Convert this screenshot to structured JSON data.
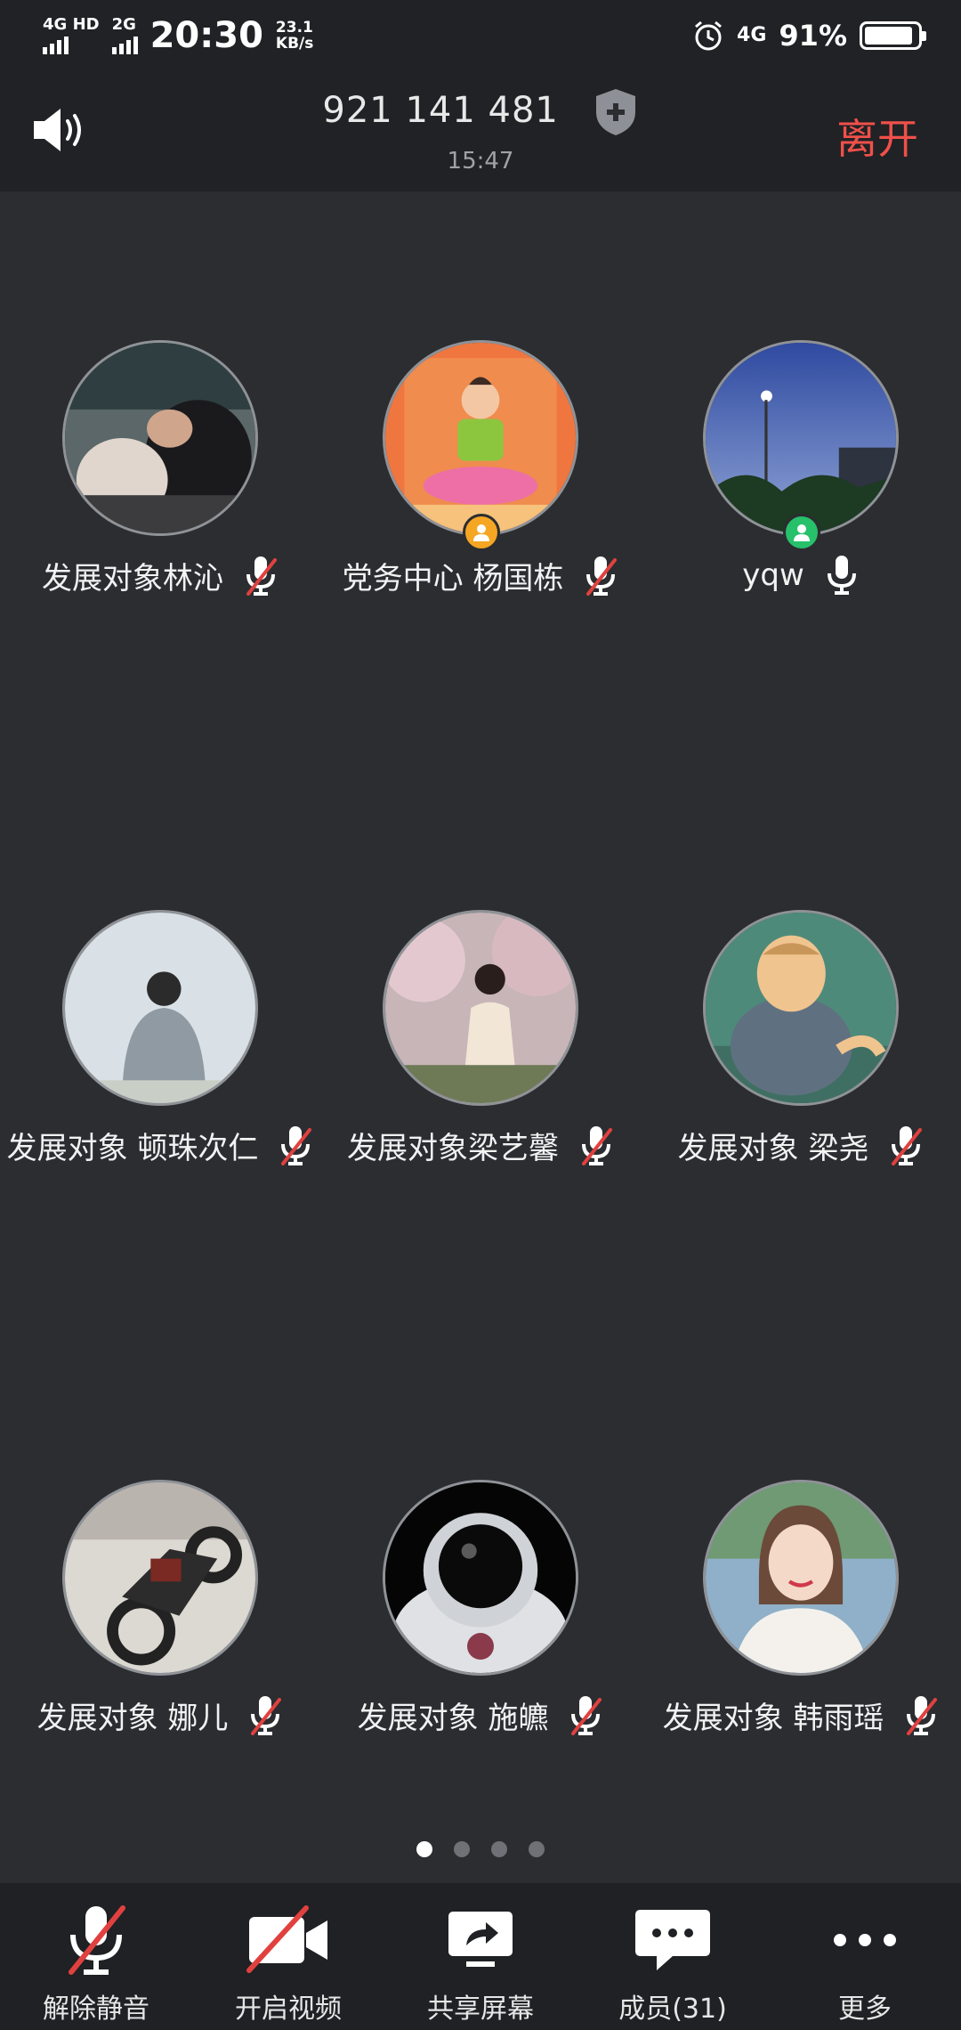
{
  "status_bar": {
    "network1": "4G HD",
    "network2": "2G",
    "time": "20:30",
    "speed_value": "23.1",
    "speed_unit": "KB/s",
    "network3": "4G",
    "battery": "91%",
    "battery_level": 0.91
  },
  "header": {
    "meeting_id": "921 141 481",
    "duration": "15:47",
    "leave_label": "离开"
  },
  "participants": [
    {
      "name": "发展对象林沁",
      "mic": "muted",
      "avatar_icon": "photo-avatar",
      "host": null
    },
    {
      "name": "党务中心 杨国栋",
      "mic": "muted",
      "avatar_icon": "cartoon-yoga-avatar",
      "host": "cohost"
    },
    {
      "name": "yqw",
      "mic": "active",
      "avatar_icon": "night-street-avatar",
      "host": "host"
    },
    {
      "name": "发展对象 顿珠次仁",
      "mic": "muted",
      "avatar_icon": "person-back-avatar",
      "host": null
    },
    {
      "name": "发展对象梁艺馨",
      "mic": "muted",
      "avatar_icon": "cherry-blossom-avatar",
      "host": null
    },
    {
      "name": "发展对象 梁尧",
      "mic": "muted",
      "avatar_icon": "cartoon-man-avatar",
      "host": null
    },
    {
      "name": "发展对象 娜儿",
      "mic": "muted",
      "avatar_icon": "motorcycle-avatar",
      "host": null
    },
    {
      "name": "发展对象 施皫",
      "mic": "muted",
      "avatar_icon": "astronaut-avatar",
      "host": null
    },
    {
      "name": "发展对象 韩雨瑶",
      "mic": "muted",
      "avatar_icon": "portrait-girl-avatar",
      "host": null
    }
  ],
  "pagination": {
    "pages": 4,
    "current": 1
  },
  "toolbar": {
    "unmute_label": "解除静音",
    "video_label": "开启视频",
    "share_label": "共享屏幕",
    "members_label": "成员(31)",
    "more_label": "更多"
  },
  "colors": {
    "background": "#2b2d31",
    "header_bg": "#202225",
    "leave_red": "#f0504a",
    "muted_red": "#e0413f",
    "host_green": "#27c06b",
    "cohost_orange": "#f5a623"
  }
}
